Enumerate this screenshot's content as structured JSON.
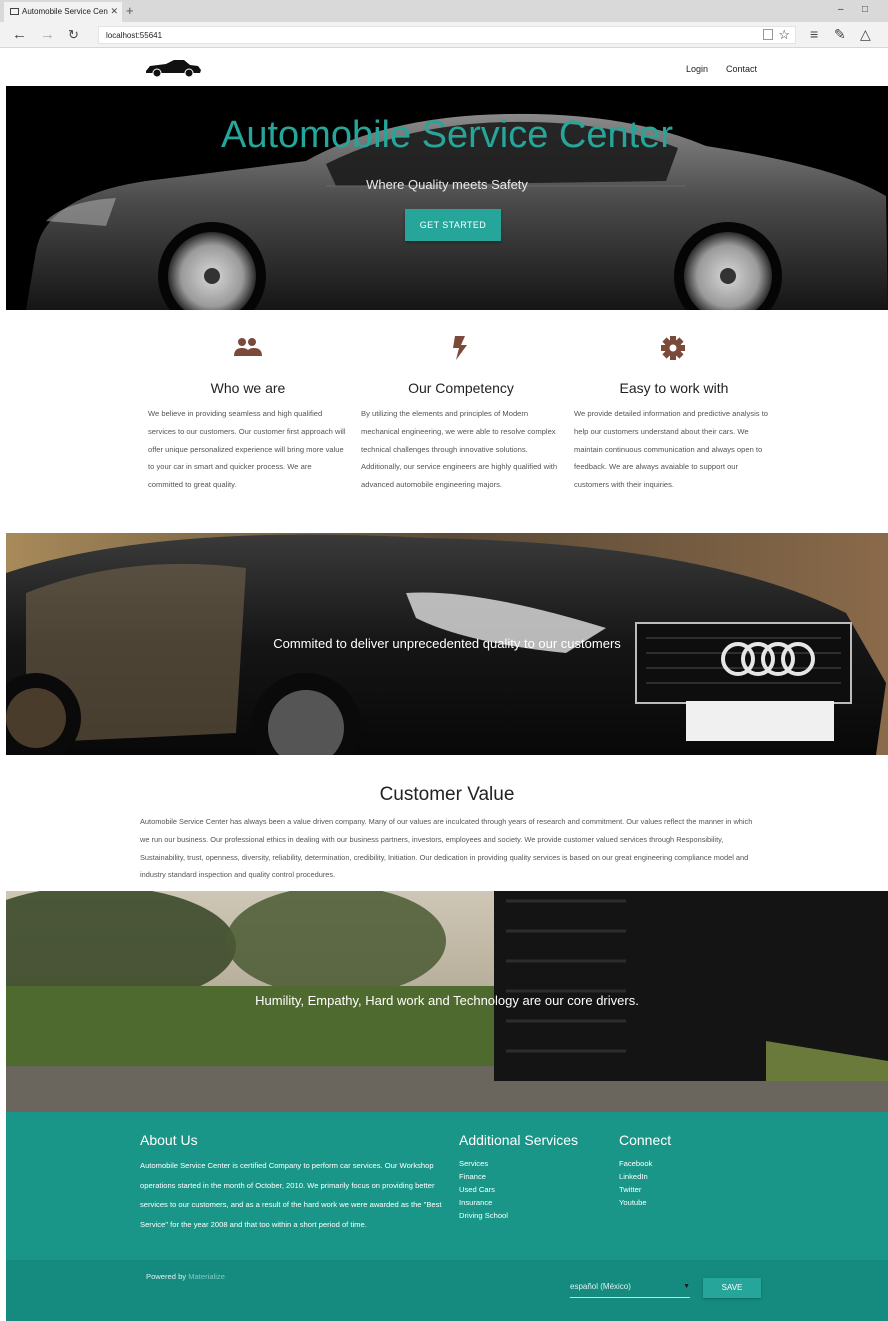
{
  "browser": {
    "tab_title": "Automobile Service Cen",
    "tab_close": "✕",
    "new_tab": "+",
    "url": "localhost:55641",
    "nav_icons": [
      "back-arrow-icon",
      "forward-arrow-icon",
      "refresh-icon"
    ],
    "window_icons": [
      "minimize-icon",
      "restore-icon"
    ],
    "tool_icons": [
      "hub-icon",
      "web-note-icon",
      "share-icon"
    ]
  },
  "navbar": {
    "logo_icon": "car-logo-icon",
    "links": [
      "Login",
      "Contact"
    ]
  },
  "hero": {
    "title": "Automobile Service Center",
    "subtitle": "Where Quality meets Safety",
    "cta_label": "GET STARTED",
    "accent": "#26a69a"
  },
  "features": [
    {
      "icon": "people-icon",
      "title": "Who we are",
      "text": "We believe in providing seamless and high qualified services to our customers. Our customer first approach will offer unique personalized experience will bring more value to your car in smart and quicker process. We are committed to great quality."
    },
    {
      "icon": "lightning-bolt-icon",
      "title": "Our Competency",
      "text": "By utilizing the elements and principles of Modern mechanical engineering, we were able to resolve complex technical challenges through innovative solutions. Additionally, our service engineers are highly qualified with advanced automobile engineering majors."
    },
    {
      "icon": "gear-icon",
      "title": "Easy to work with",
      "text": "We provide detailed information and predictive analysis to help our customers understand about their cars. We maintain continuous communication and always open to feedback. We are always avaiable to support our customers with their inquiries."
    }
  ],
  "parallax1": {
    "text": "Commited to deliver unprecedented quality to our customers"
  },
  "customer_value": {
    "title": "Customer Value",
    "text": "Automobile Service Center has always been a value driven company. Many of our values are inculcated through years of research and commitment. Our values reflect the manner in which we run our business. Our professional ethics in dealing with our business partners, investors, employees and society. We provide customer valued services through Responsibility, Sustainability, trust, openness, diversity, reliability, determination, credibility, Initiation. Our dedication in providing quality services is based on our great engineering compliance model and industry standard inspection and quality control procedures."
  },
  "parallax2": {
    "text": "Humility, Empathy, Hard work and Technology are our core drivers."
  },
  "footer": {
    "about_title": "About Us",
    "about_text": "Automobile Service Center is certified Company to perform car services. Our Workshop operations started in the month of October, 2010. We primarily focus on providing better services to our customers, and as a result of the hard work we were awarded as the \"Best Service\" for the year 2008 and that too within a short period of time.",
    "services_title": "Additional Services",
    "services": [
      "Services",
      "Finance",
      "Used Cars",
      "Insurance",
      "Driving School"
    ],
    "connect_title": "Connect",
    "connect": [
      "Facebook",
      "LinkedIn",
      "Twitter",
      "Youtube"
    ],
    "powered_prefix": "Powered by",
    "powered_link": "Materialize",
    "language": "español (México)",
    "save_label": "SAVE",
    "bg_color": "#1a9689"
  }
}
